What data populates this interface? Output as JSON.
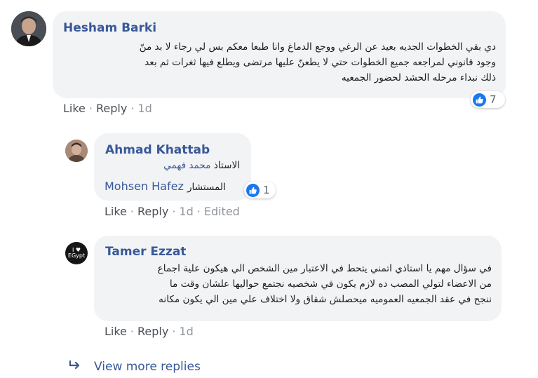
{
  "comments": [
    {
      "author": "Hesham Barki",
      "text_lines": [
        "دي بقي الخطوات الجديه بعيد عن الرغي ووجع الدماغ وانا طبعا معكم بس لي رجاء لا بد منّ",
        "وجود قانوني لمراجعه جميع الخطوات حتي لا يطعنّ عليها مرتضى ويطلع فيها ثغرات ثم بعد",
        "ذلك نبداء مرحله الحشد لحضور الجمعيه"
      ],
      "reaction_count": "7",
      "actions": {
        "like": "Like",
        "reply": "Reply",
        "time": "1d"
      }
    },
    {
      "author": "Ahmad Khattab",
      "line1_prefix": "الاستاذ",
      "line1_mention": "محمد فهمي",
      "line2_mention": "Mohsen Hafez",
      "line2_suffix": "المستشار",
      "reaction_count": "1",
      "actions": {
        "like": "Like",
        "reply": "Reply",
        "time": "1d",
        "edited": "Edited"
      }
    },
    {
      "author": "Tamer Ezzat",
      "avatar_text": "I ♥ EGypt",
      "text_lines": [
        "في سؤال مهم يا استاذي اتمني يتحط في الاعتبار مين الشخص الي هيكون علية اجماع",
        "من الاعضاء لتولي المصب ده لازم يكون في شخصيه نجتمع حواليها علشان وقت ما",
        "ننجح في عقد الجمعيه العموميه ميحصلش شقاق ولا اختلاف علي مين الي يكون مكانه"
      ],
      "actions": {
        "like": "Like",
        "reply": "Reply",
        "time": "1d"
      }
    }
  ],
  "view_more": "View more replies",
  "icons": {
    "like": "thumbs-up-icon",
    "reply_arrow": "reply-arrow-icon"
  },
  "colors": {
    "link": "#385898",
    "bubble": "#f2f3f5",
    "like_blue": "#1877f2",
    "meta": "#90949c"
  }
}
